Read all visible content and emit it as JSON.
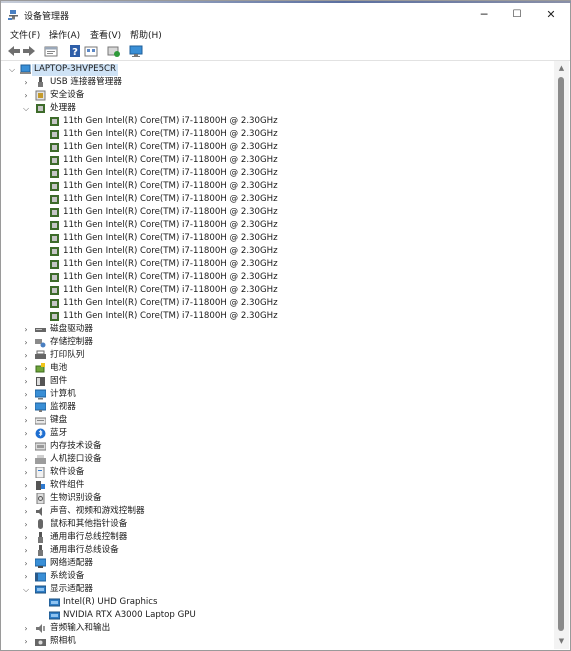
{
  "window": {
    "title": "设备管理器",
    "controls": {
      "minimize": "─",
      "maximize": "☐",
      "close": "✕"
    }
  },
  "menu": [
    "文件(F)",
    "操作(A)",
    "查看(V)",
    "帮助(H)"
  ],
  "toolbar": [
    "back-arrow-icon",
    "forward-arrow-icon",
    "properties-icon",
    "help-icon",
    "view-icon",
    "scan-hardware-icon",
    "monitor-icon"
  ],
  "tree": {
    "root": {
      "label": "LAPTOP-3HVPE5CR",
      "expanded": true,
      "selected": true
    },
    "categories": [
      {
        "label": "USB 连接器管理器",
        "icon": "usb-icon",
        "expanded": false
      },
      {
        "label": "安全设备",
        "icon": "security-icon",
        "expanded": false
      },
      {
        "label": "处理器",
        "icon": "processor-icon",
        "expanded": true,
        "children": [
          "11th Gen Intel(R) Core(TM) i7-11800H @ 2.30GHz",
          "11th Gen Intel(R) Core(TM) i7-11800H @ 2.30GHz",
          "11th Gen Intel(R) Core(TM) i7-11800H @ 2.30GHz",
          "11th Gen Intel(R) Core(TM) i7-11800H @ 2.30GHz",
          "11th Gen Intel(R) Core(TM) i7-11800H @ 2.30GHz",
          "11th Gen Intel(R) Core(TM) i7-11800H @ 2.30GHz",
          "11th Gen Intel(R) Core(TM) i7-11800H @ 2.30GHz",
          "11th Gen Intel(R) Core(TM) i7-11800H @ 2.30GHz",
          "11th Gen Intel(R) Core(TM) i7-11800H @ 2.30GHz",
          "11th Gen Intel(R) Core(TM) i7-11800H @ 2.30GHz",
          "11th Gen Intel(R) Core(TM) i7-11800H @ 2.30GHz",
          "11th Gen Intel(R) Core(TM) i7-11800H @ 2.30GHz",
          "11th Gen Intel(R) Core(TM) i7-11800H @ 2.30GHz",
          "11th Gen Intel(R) Core(TM) i7-11800H @ 2.30GHz",
          "11th Gen Intel(R) Core(TM) i7-11800H @ 2.30GHz",
          "11th Gen Intel(R) Core(TM) i7-11800H @ 2.30GHz"
        ]
      },
      {
        "label": "磁盘驱动器",
        "icon": "disk-icon",
        "expanded": false
      },
      {
        "label": "存储控制器",
        "icon": "storage-controller-icon",
        "expanded": false
      },
      {
        "label": "打印队列",
        "icon": "printer-icon",
        "expanded": false
      },
      {
        "label": "电池",
        "icon": "battery-icon",
        "expanded": false
      },
      {
        "label": "固件",
        "icon": "firmware-icon",
        "expanded": false
      },
      {
        "label": "计算机",
        "icon": "computer-icon",
        "expanded": false
      },
      {
        "label": "监视器",
        "icon": "monitor-icon",
        "expanded": false
      },
      {
        "label": "键盘",
        "icon": "keyboard-icon",
        "expanded": false
      },
      {
        "label": "蓝牙",
        "icon": "bluetooth-icon",
        "expanded": false
      },
      {
        "label": "内存技术设备",
        "icon": "memory-icon",
        "expanded": false
      },
      {
        "label": "人机接口设备",
        "icon": "hid-icon",
        "expanded": false
      },
      {
        "label": "软件设备",
        "icon": "software-device-icon",
        "expanded": false
      },
      {
        "label": "软件组件",
        "icon": "software-component-icon",
        "expanded": false
      },
      {
        "label": "生物识别设备",
        "icon": "biometric-icon",
        "expanded": false
      },
      {
        "label": "声音、视频和游戏控制器",
        "icon": "speaker-icon",
        "expanded": false
      },
      {
        "label": "鼠标和其他指针设备",
        "icon": "mouse-icon",
        "expanded": false
      },
      {
        "label": "通用串行总线控制器",
        "icon": "usb-controller-icon",
        "expanded": false
      },
      {
        "label": "通用串行总线设备",
        "icon": "usb-device-icon",
        "expanded": false
      },
      {
        "label": "网络适配器",
        "icon": "network-icon",
        "expanded": false
      },
      {
        "label": "系统设备",
        "icon": "system-device-icon",
        "expanded": false
      },
      {
        "label": "显示适配器",
        "icon": "display-adapter-icon",
        "expanded": true,
        "children": [
          "Intel(R) UHD Graphics",
          "NVIDIA RTX A3000 Laptop GPU"
        ]
      },
      {
        "label": "音频输入和输出",
        "icon": "audio-io-icon",
        "expanded": false
      },
      {
        "label": "照相机",
        "icon": "camera-icon",
        "expanded": false
      }
    ]
  },
  "colors": {
    "selection": "#cfe3f6",
    "chip": "#3d6b2a",
    "screen": "#3a8fd6"
  }
}
